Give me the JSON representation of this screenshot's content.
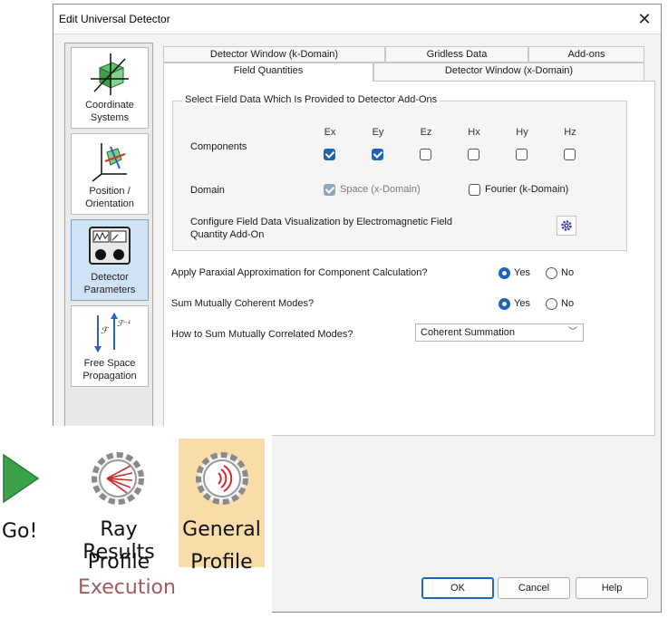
{
  "dialog": {
    "title": "Edit Universal Detector",
    "close_glyph": "✕"
  },
  "nav": {
    "items": [
      {
        "label": "Coordinate Systems",
        "icon": "coordinate-cube-icon"
      },
      {
        "label": "Position / Orientation",
        "icon": "position-axes-icon"
      },
      {
        "label": "Detector Parameters",
        "icon": "detector-meter-icon",
        "active": true
      },
      {
        "label": "Free Space Propagation",
        "icon": "fourier-transform-icon"
      }
    ]
  },
  "tabs": {
    "row1": [
      "Detector Window (k-Domain)",
      "Gridless Data",
      "Add-ons"
    ],
    "row2": [
      "Field Quantities",
      "Detector Window (x-Domain)"
    ],
    "active": "Field Quantities"
  },
  "group": {
    "title": "Select Field Data Which Is Provided to Detector Add-Ons",
    "components_label": "Components",
    "components": [
      {
        "name": "Ex",
        "checked": true
      },
      {
        "name": "Ey",
        "checked": true
      },
      {
        "name": "Ez",
        "checked": false
      },
      {
        "name": "Hx",
        "checked": false
      },
      {
        "name": "Hy",
        "checked": false
      },
      {
        "name": "Hz",
        "checked": false
      }
    ],
    "domain_label": "Domain",
    "domain_space": "Space (x-Domain)",
    "domain_fourier": "Fourier (k-Domain)",
    "configure_line1": "Configure Field Data Visualization by Electromagnetic Field",
    "configure_line2": "Quantity Add-On"
  },
  "options": {
    "paraxial_label": "Apply Paraxial Approximation for Component Calculation?",
    "coherent_label": "Sum Mutually Coherent Modes?",
    "correlated_label": "How to Sum Mutually Correlated Modes?",
    "yes": "Yes",
    "no": "No",
    "correlated_value": "Coherent Summation"
  },
  "buttons": {
    "ok": "OK",
    "cancel": "Cancel",
    "help": "Help"
  },
  "ribbon": {
    "go_label": "Go!",
    "ray_line1": "Ray Results",
    "ray_line2": "Profile",
    "general_line1": "General",
    "general_line2": "Profile",
    "group_label": "Execution"
  }
}
